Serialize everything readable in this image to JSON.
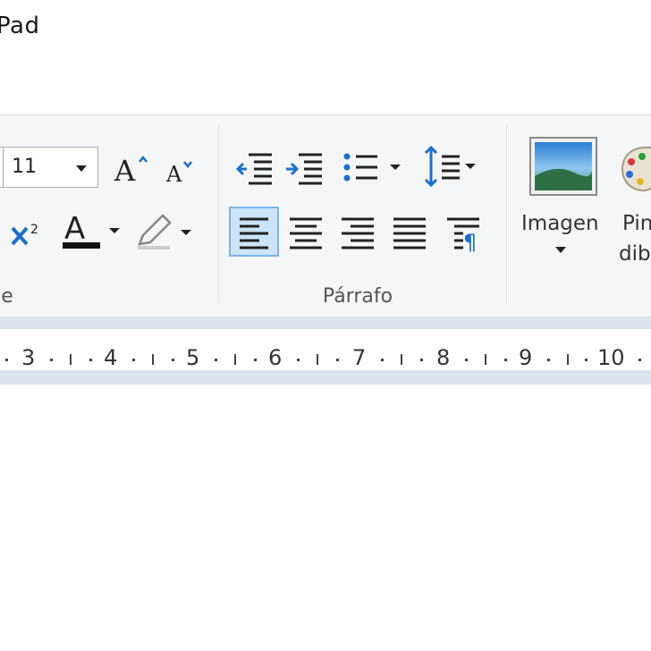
{
  "window": {
    "title_fragment": "Pad"
  },
  "ribbon": {
    "font_group": {
      "label_fragment": "e",
      "font_size": "11"
    },
    "paragraph_group": {
      "label": "Párrafo"
    },
    "insert_group": {
      "image_label": "Imagen",
      "paint_label_line1": "Pin",
      "paint_label_line2": "dib"
    }
  },
  "ruler": {
    "numbers": [
      "3",
      "4",
      "5",
      "6",
      "7",
      "8",
      "9",
      "10"
    ]
  },
  "colors": {
    "ribbon_bg": "#f5f6f7",
    "active_button_bg": "#cde4f7",
    "active_button_border": "#7eb4ea",
    "ruler_bg": "#dbe3ec",
    "icon_blue": "#1e6fc8"
  }
}
